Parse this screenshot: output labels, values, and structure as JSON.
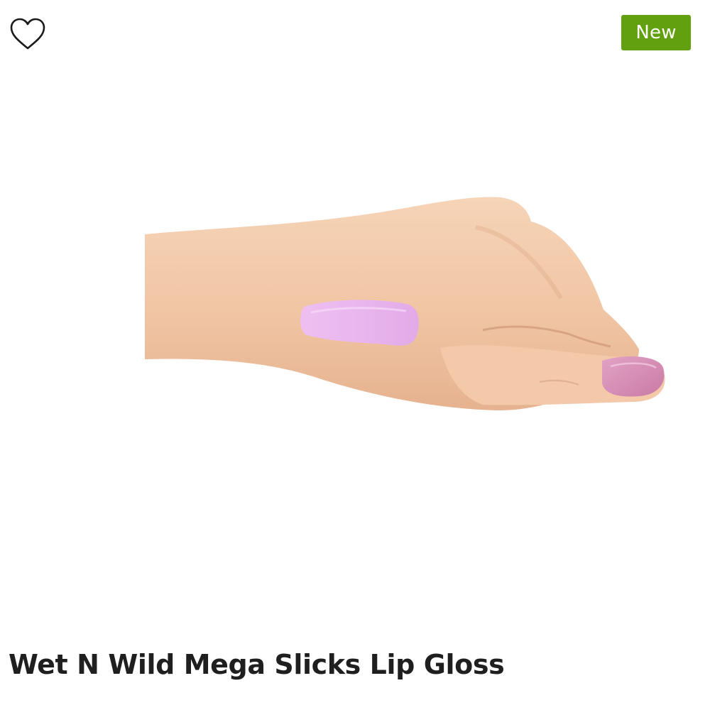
{
  "product": {
    "title": "Wet N Wild Mega Slicks Lip Gloss",
    "badge": "New",
    "wishlist_icon": "heart-outline-icon",
    "image": {
      "subject": "hand-swatch",
      "swatch_color": "#e8b8ec",
      "nail_color": "#d58bb4",
      "skin_color": "#f1c8a8"
    }
  },
  "colors": {
    "badge_bg": "#62a00f",
    "badge_text": "#ffffff",
    "title_text": "#1f1f1f"
  }
}
